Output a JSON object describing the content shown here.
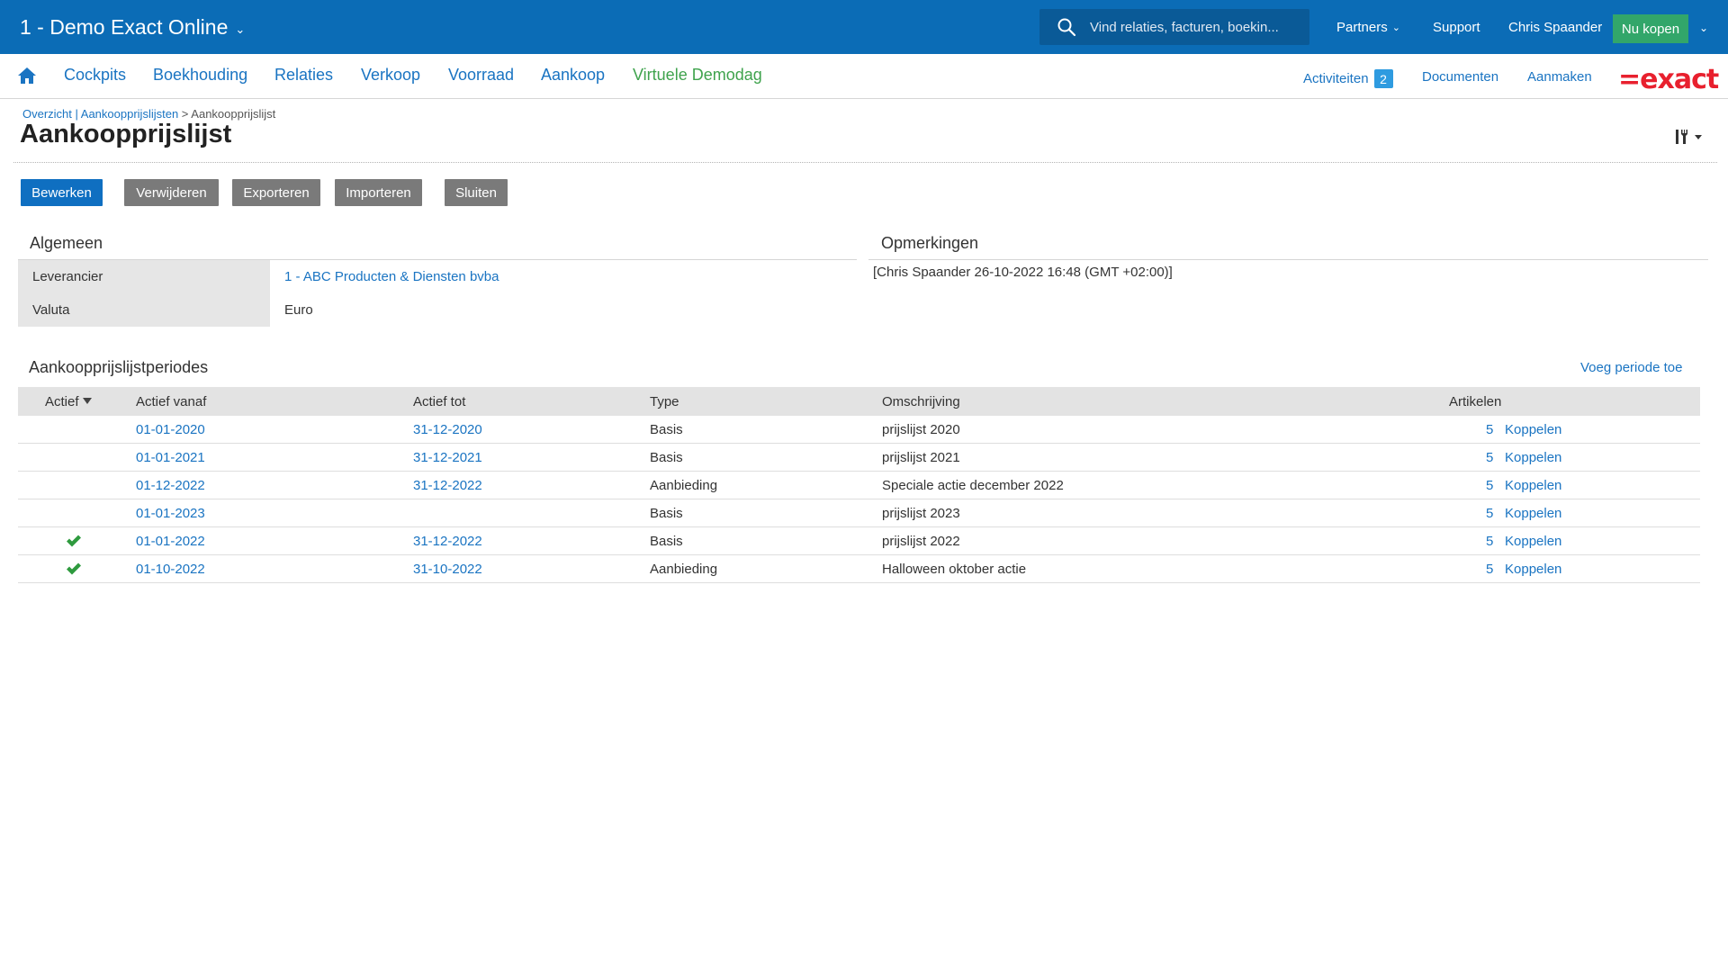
{
  "topbar": {
    "app_title": "1 - Demo Exact Online",
    "search_placeholder": "Vind relaties, facturen, boekin...",
    "partners": "Partners",
    "support": "Support",
    "user": "Chris Spaander",
    "buy": "Nu kopen",
    "color": "#0b6cb6"
  },
  "nav": {
    "items": [
      "Cockpits",
      "Boekhouding",
      "Relaties",
      "Verkoop",
      "Voorraad",
      "Aankoop",
      "Virtuele Demodag"
    ],
    "activities": "Activiteiten",
    "activities_count": "2",
    "documents": "Documenten",
    "create": "Aanmaken",
    "logo": "=exact"
  },
  "header": {
    "breadcrumb_link": "Overzicht | Aankoopprijslijsten",
    "breadcrumb_sep": " > ",
    "breadcrumb_current": "Aankoopprijslijst",
    "title": "Aankoopprijslijst"
  },
  "toolbar": {
    "edit": "Bewerken",
    "delete": "Verwijderen",
    "export": "Exporteren",
    "import": "Importeren",
    "close": "Sluiten"
  },
  "general": {
    "title": "Algemeen",
    "supplier_label": "Leverancier",
    "supplier_value": "1 - ABC Producten & Diensten bvba",
    "currency_label": "Valuta",
    "currency_value": "Euro"
  },
  "remarks": {
    "title": "Opmerkingen",
    "text": "[Chris Spaander 26-10-2022 16:48 (GMT +02:00)]"
  },
  "periods": {
    "title": "Aankoopprijslijstperiodes",
    "add_link": "Voeg periode toe",
    "columns": {
      "active": "Actief",
      "from": "Actief vanaf",
      "to": "Actief tot",
      "type": "Type",
      "description": "Omschrijving",
      "items": "Artikelen"
    },
    "link_label": "Koppelen",
    "rows": [
      {
        "active": false,
        "from": "01-01-2020",
        "to": "31-12-2020",
        "type": "Basis",
        "description": "prijslijst 2020",
        "items": "5"
      },
      {
        "active": false,
        "from": "01-01-2021",
        "to": "31-12-2021",
        "type": "Basis",
        "description": "prijslijst 2021",
        "items": "5"
      },
      {
        "active": false,
        "from": "01-12-2022",
        "to": "31-12-2022",
        "type": "Aanbieding",
        "description": "Speciale actie december 2022",
        "items": "5"
      },
      {
        "active": false,
        "from": "01-01-2023",
        "to": "",
        "type": "Basis",
        "description": "prijslijst 2023",
        "items": "5"
      },
      {
        "active": true,
        "from": "01-01-2022",
        "to": "31-12-2022",
        "type": "Basis",
        "description": "prijslijst 2022",
        "items": "5"
      },
      {
        "active": true,
        "from": "01-10-2022",
        "to": "31-10-2022",
        "type": "Aanbieding",
        "description": "Halloween oktober actie",
        "items": "5"
      }
    ]
  }
}
